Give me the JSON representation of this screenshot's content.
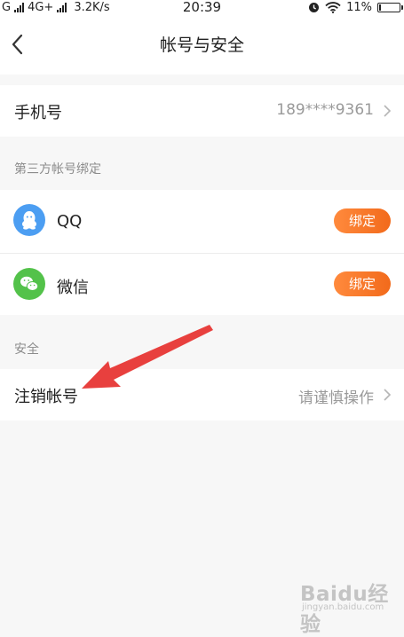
{
  "status_bar": {
    "network": "G",
    "network2": "4G+",
    "speed": "3.2K/s",
    "time": "20:39",
    "battery": "11%",
    "battery_level": 0.11
  },
  "header": {
    "title": "帐号与安全",
    "back_icon": "chevron-left-icon"
  },
  "phone": {
    "label": "手机号",
    "value": "189****9361"
  },
  "third_party": {
    "section_title": "第三方帐号绑定",
    "items": [
      {
        "name": "QQ",
        "icon": "qq-icon",
        "color": "#4c9ef2",
        "action": "绑定"
      },
      {
        "name": "微信",
        "icon": "wechat-icon",
        "color": "#53c24a",
        "action": "绑定"
      }
    ]
  },
  "security": {
    "section_title": "安全",
    "cancel_account": {
      "label": "注销帐号",
      "hint": "请谨慎操作"
    }
  },
  "colors": {
    "accent": "#f26a1b",
    "annotation_arrow": "#e8403e"
  },
  "watermark": {
    "logo": "Baidu经验",
    "url": "jingyan.baidu.com"
  }
}
